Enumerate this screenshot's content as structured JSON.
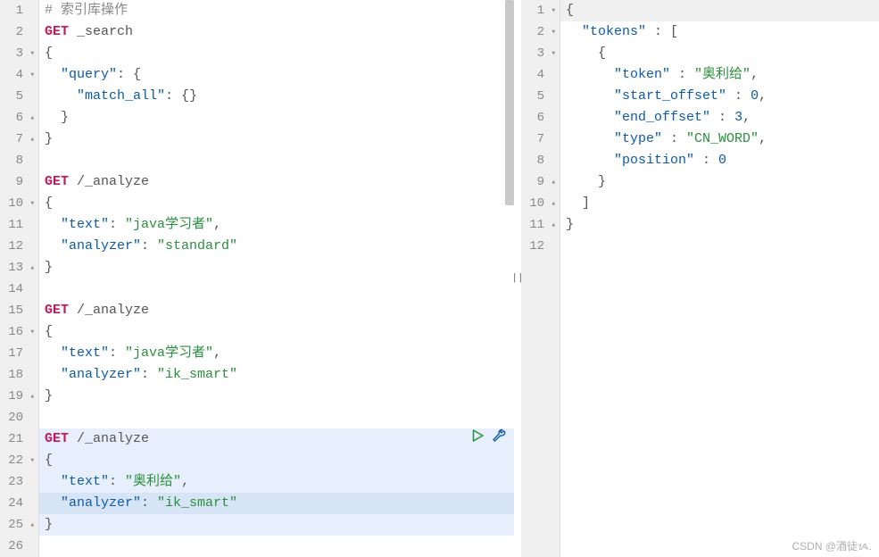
{
  "left": {
    "lines": [
      {
        "n": "1",
        "fold": "",
        "tokens": [
          {
            "t": "# ",
            "c": "comment"
          },
          {
            "t": "索引库操作",
            "c": "comment"
          }
        ]
      },
      {
        "n": "2",
        "fold": "",
        "tokens": [
          {
            "t": "GET",
            "c": "kw"
          },
          {
            "t": " _search",
            "c": "path"
          }
        ]
      },
      {
        "n": "3",
        "fold": "▾",
        "tokens": [
          {
            "t": "{",
            "c": "punc"
          }
        ]
      },
      {
        "n": "4",
        "fold": "▾",
        "tokens": [
          {
            "t": "  ",
            "c": ""
          },
          {
            "t": "\"query\"",
            "c": "key"
          },
          {
            "t": ": {",
            "c": "punc"
          }
        ]
      },
      {
        "n": "5",
        "fold": "",
        "tokens": [
          {
            "t": "    ",
            "c": ""
          },
          {
            "t": "\"match_all\"",
            "c": "key"
          },
          {
            "t": ": {}",
            "c": "punc"
          }
        ]
      },
      {
        "n": "6",
        "fold": "▴",
        "tokens": [
          {
            "t": "  }",
            "c": "punc"
          }
        ]
      },
      {
        "n": "7",
        "fold": "▴",
        "tokens": [
          {
            "t": "}",
            "c": "punc"
          }
        ]
      },
      {
        "n": "8",
        "fold": "",
        "tokens": []
      },
      {
        "n": "9",
        "fold": "",
        "tokens": [
          {
            "t": "GET",
            "c": "kw"
          },
          {
            "t": " /_analyze",
            "c": "path"
          }
        ]
      },
      {
        "n": "10",
        "fold": "▾",
        "tokens": [
          {
            "t": "{",
            "c": "punc"
          }
        ]
      },
      {
        "n": "11",
        "fold": "",
        "tokens": [
          {
            "t": "  ",
            "c": ""
          },
          {
            "t": "\"text\"",
            "c": "key"
          },
          {
            "t": ": ",
            "c": "punc"
          },
          {
            "t": "\"java学习者\"",
            "c": "str"
          },
          {
            "t": ",",
            "c": "punc"
          }
        ]
      },
      {
        "n": "12",
        "fold": "",
        "tokens": [
          {
            "t": "  ",
            "c": ""
          },
          {
            "t": "\"analyzer\"",
            "c": "key"
          },
          {
            "t": ": ",
            "c": "punc"
          },
          {
            "t": "\"standard\"",
            "c": "str"
          }
        ]
      },
      {
        "n": "13",
        "fold": "▴",
        "tokens": [
          {
            "t": "}",
            "c": "punc"
          }
        ]
      },
      {
        "n": "14",
        "fold": "",
        "tokens": []
      },
      {
        "n": "15",
        "fold": "",
        "tokens": [
          {
            "t": "GET",
            "c": "kw"
          },
          {
            "t": " /_analyze",
            "c": "path"
          }
        ]
      },
      {
        "n": "16",
        "fold": "▾",
        "tokens": [
          {
            "t": "{",
            "c": "punc"
          }
        ]
      },
      {
        "n": "17",
        "fold": "",
        "tokens": [
          {
            "t": "  ",
            "c": ""
          },
          {
            "t": "\"text\"",
            "c": "key"
          },
          {
            "t": ": ",
            "c": "punc"
          },
          {
            "t": "\"java学习者\"",
            "c": "str"
          },
          {
            "t": ",",
            "c": "punc"
          }
        ]
      },
      {
        "n": "18",
        "fold": "",
        "tokens": [
          {
            "t": "  ",
            "c": ""
          },
          {
            "t": "\"analyzer\"",
            "c": "key"
          },
          {
            "t": ": ",
            "c": "punc"
          },
          {
            "t": "\"ik_smart\"",
            "c": "str"
          }
        ]
      },
      {
        "n": "19",
        "fold": "▴",
        "tokens": [
          {
            "t": "}",
            "c": "punc"
          }
        ]
      },
      {
        "n": "20",
        "fold": "",
        "tokens": []
      },
      {
        "n": "21",
        "fold": "",
        "hl": "blue",
        "actions": true,
        "tokens": [
          {
            "t": "GET",
            "c": "kw"
          },
          {
            "t": " /_analyze",
            "c": "path"
          }
        ]
      },
      {
        "n": "22",
        "fold": "▾",
        "hl": "blue",
        "tokens": [
          {
            "t": "{",
            "c": "punc"
          }
        ]
      },
      {
        "n": "23",
        "fold": "",
        "hl": "blue",
        "tokens": [
          {
            "t": "  ",
            "c": ""
          },
          {
            "t": "\"text\"",
            "c": "key"
          },
          {
            "t": ": ",
            "c": "punc"
          },
          {
            "t": "\"奥利给\"",
            "c": "str"
          },
          {
            "t": ",",
            "c": "punc"
          }
        ]
      },
      {
        "n": "24",
        "fold": "",
        "hl": "blue-strong",
        "tokens": [
          {
            "t": "  ",
            "c": ""
          },
          {
            "t": "\"analyzer\"",
            "c": "key"
          },
          {
            "t": ": ",
            "c": "punc"
          },
          {
            "t": "\"ik_smart\"",
            "c": "str"
          }
        ]
      },
      {
        "n": "25",
        "fold": "▴",
        "hl": "blue",
        "tokens": [
          {
            "t": "}",
            "c": "punc"
          }
        ]
      },
      {
        "n": "26",
        "fold": "",
        "tokens": []
      }
    ]
  },
  "right": {
    "lines": [
      {
        "n": "1",
        "fold": "▾",
        "hl": "right",
        "tokens": [
          {
            "t": "{",
            "c": "punc"
          }
        ]
      },
      {
        "n": "2",
        "fold": "▾",
        "tokens": [
          {
            "t": "  ",
            "c": ""
          },
          {
            "t": "\"tokens\"",
            "c": "key"
          },
          {
            "t": " : [",
            "c": "punc"
          }
        ]
      },
      {
        "n": "3",
        "fold": "▾",
        "tokens": [
          {
            "t": "    {",
            "c": "punc"
          }
        ]
      },
      {
        "n": "4",
        "fold": "",
        "tokens": [
          {
            "t": "      ",
            "c": ""
          },
          {
            "t": "\"token\"",
            "c": "key"
          },
          {
            "t": " : ",
            "c": "punc"
          },
          {
            "t": "\"奥利给\"",
            "c": "str"
          },
          {
            "t": ",",
            "c": "punc"
          }
        ]
      },
      {
        "n": "5",
        "fold": "",
        "tokens": [
          {
            "t": "      ",
            "c": ""
          },
          {
            "t": "\"start_offset\"",
            "c": "key"
          },
          {
            "t": " : ",
            "c": "punc"
          },
          {
            "t": "0",
            "c": "num"
          },
          {
            "t": ",",
            "c": "punc"
          }
        ]
      },
      {
        "n": "6",
        "fold": "",
        "tokens": [
          {
            "t": "      ",
            "c": ""
          },
          {
            "t": "\"end_offset\"",
            "c": "key"
          },
          {
            "t": " : ",
            "c": "punc"
          },
          {
            "t": "3",
            "c": "num"
          },
          {
            "t": ",",
            "c": "punc"
          }
        ]
      },
      {
        "n": "7",
        "fold": "",
        "tokens": [
          {
            "t": "      ",
            "c": ""
          },
          {
            "t": "\"type\"",
            "c": "key"
          },
          {
            "t": " : ",
            "c": "punc"
          },
          {
            "t": "\"CN_WORD\"",
            "c": "str"
          },
          {
            "t": ",",
            "c": "punc"
          }
        ]
      },
      {
        "n": "8",
        "fold": "",
        "tokens": [
          {
            "t": "      ",
            "c": ""
          },
          {
            "t": "\"position\"",
            "c": "key"
          },
          {
            "t": " : ",
            "c": "punc"
          },
          {
            "t": "0",
            "c": "num"
          }
        ]
      },
      {
        "n": "9",
        "fold": "▴",
        "tokens": [
          {
            "t": "    }",
            "c": "punc"
          }
        ]
      },
      {
        "n": "10",
        "fold": "▴",
        "tokens": [
          {
            "t": "  ]",
            "c": "punc"
          }
        ]
      },
      {
        "n": "11",
        "fold": "▴",
        "tokens": [
          {
            "t": "}",
            "c": "punc"
          }
        ]
      },
      {
        "n": "12",
        "fold": "",
        "tokens": []
      }
    ]
  },
  "watermark": "CSDN @酒徒ᝰ."
}
